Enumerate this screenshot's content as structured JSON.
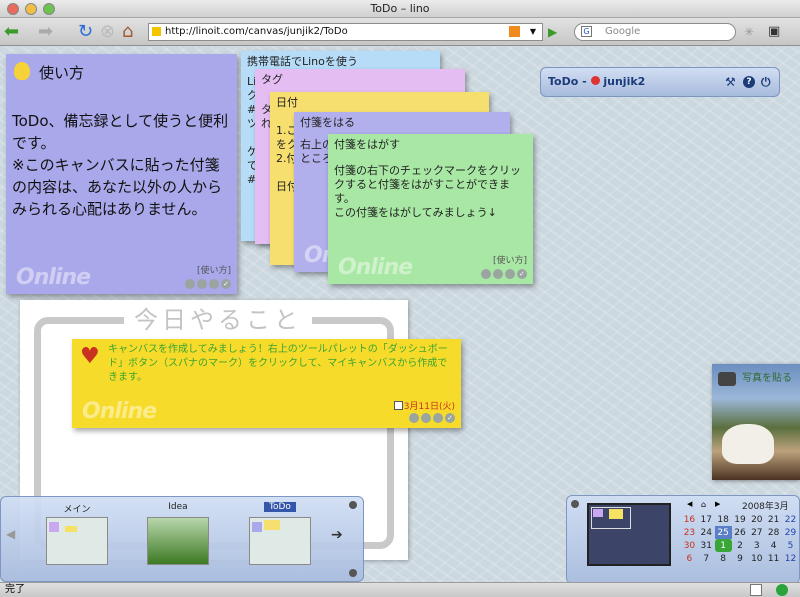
{
  "window": {
    "title": "ToDo – lino"
  },
  "toolbar": {
    "url": "http://linoit.com/canvas/junjik2/ToDo",
    "search_placeholder": "Google"
  },
  "notes": {
    "howto": {
      "title": "使い方",
      "body": "ToDo、備忘録として使うと便利です。\n※このキャンバスに貼った付箋の内容は、あなた以外の人からみられる心配はありません。",
      "tag": "[使い方]",
      "color": "#a9a8ea"
    },
    "mobile": {
      "title": "携帯電話でLinoを使う",
      "body": "Lino\nク\n#\nツ\n\nケ\nで\n#",
      "color": "#b6dcf7"
    },
    "tag": {
      "title": "タグ",
      "body": "タ\nれ",
      "color": "#e4bdf2"
    },
    "date": {
      "title": "日付",
      "body": "1.こ\nをク\n2.付\n\n日付",
      "color": "#f7df6f"
    },
    "stick": {
      "title": "付箋をはる",
      "body": "右上の\nところ",
      "color": "#b1afec"
    },
    "peel": {
      "title": "付箋をはがす",
      "body": "付箋の右下のチェックマークをクリックすると付箋をはがすことができます。\nこの付箋をはがしてみましょう↓",
      "tag": "[使い方]",
      "color": "#a8e8a4"
    },
    "create": {
      "body": "キャンバスを作成してみましょう！右上のツールパレットの「ダッシュボード」ボタン（スパナのマーク）をクリックして、マイキャンバスから作成できます。",
      "date": "3月11日(火)",
      "color": "#f7db2a"
    }
  },
  "brand": {
    "watermark": "Online"
  },
  "whiteboard": {
    "title": "今日やること"
  },
  "dashboard": {
    "label": "ToDo - ",
    "user": "junjik2"
  },
  "canvases": [
    {
      "name": "メイン"
    },
    {
      "name": "Idea"
    },
    {
      "name": "ToDo",
      "active": true
    }
  ],
  "photo": {
    "label": "写真を貼る"
  },
  "calendar": {
    "month": "2008年3月",
    "rows": [
      [
        "16",
        "17",
        "18",
        "19",
        "20",
        "21",
        "22"
      ],
      [
        "23",
        "24",
        "25",
        "26",
        "27",
        "28",
        "29"
      ],
      [
        "30",
        "31",
        "1",
        "2",
        "3",
        "4",
        "5"
      ],
      [
        "6",
        "7",
        "8",
        "9",
        "10",
        "11",
        "12"
      ]
    ]
  },
  "status": {
    "text": "完了"
  }
}
